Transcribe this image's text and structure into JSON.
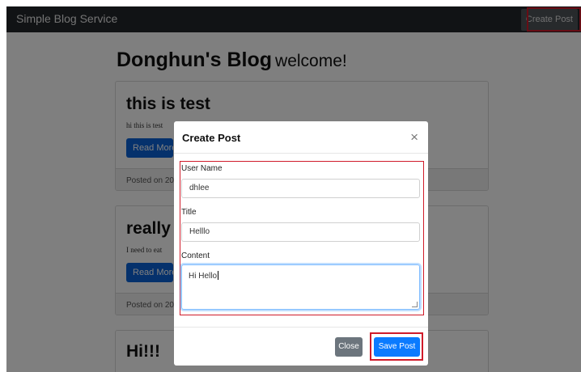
{
  "navbar": {
    "brand": "Simple Blog Service",
    "create_post_label": "Create Post"
  },
  "blog": {
    "title": "Donghun's Blog",
    "subtitle": "welcome!"
  },
  "posts": [
    {
      "title": "this is test",
      "excerpt": "hi this is test",
      "read_more": "Read More",
      "posted": "Posted on 20"
    },
    {
      "title": "really h",
      "excerpt": "I need to eat",
      "read_more": "Read More",
      "posted": "Posted on 20"
    },
    {
      "title": "Hi!!!"
    }
  ],
  "modal": {
    "title": "Create Post",
    "close_glyph": "×",
    "fields": {
      "username": {
        "label": "User Name",
        "value": "dhlee"
      },
      "title": {
        "label": "Title",
        "value": "Helllo"
      },
      "content": {
        "label": "Content",
        "value": "Hi Hello"
      }
    },
    "close_button": "Close",
    "save_button": "Save Post"
  },
  "colors": {
    "navbar": "#23272b",
    "primary": "#0b63d8",
    "secondary": "#6c757d",
    "highlight": "#d01b2a"
  }
}
